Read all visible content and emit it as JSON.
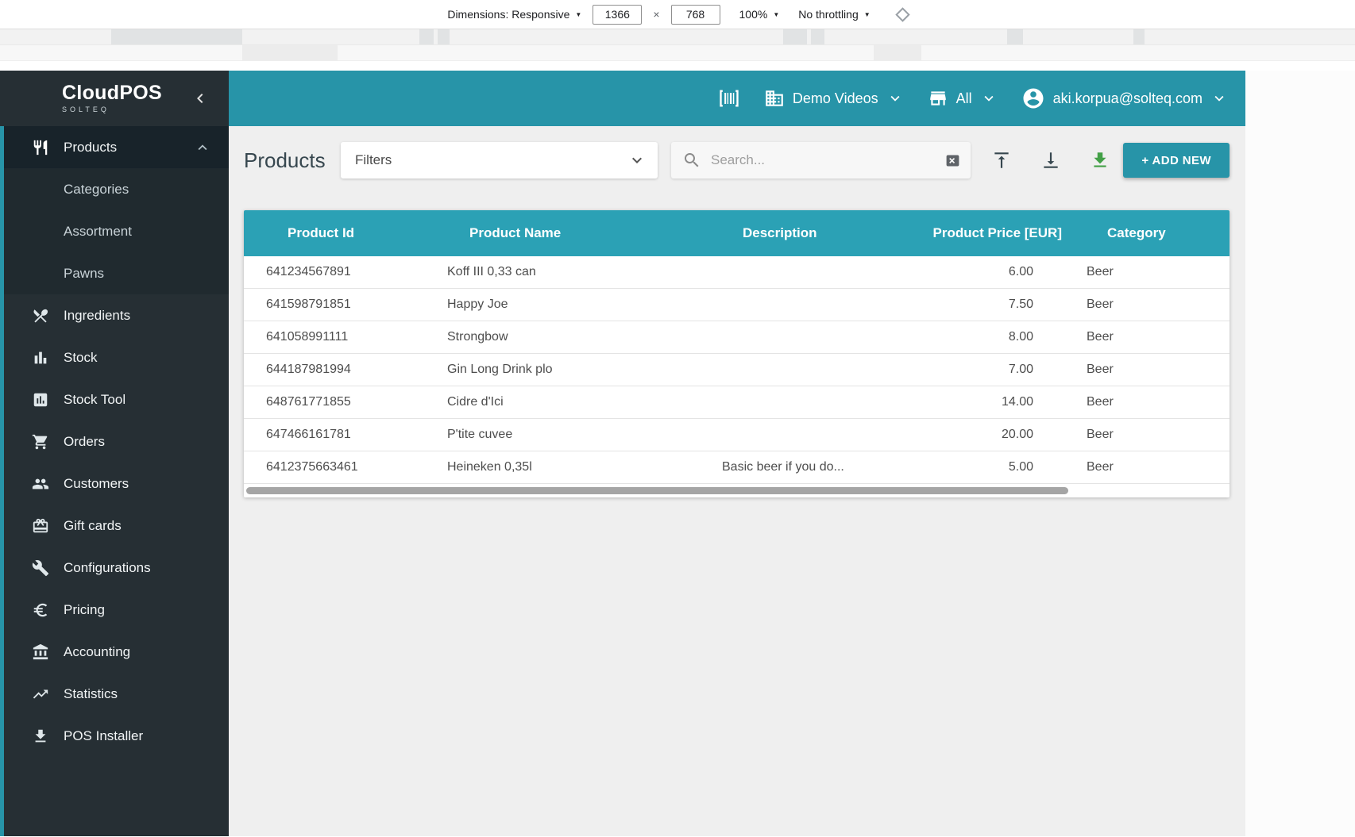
{
  "devtools": {
    "dimensions_label": "Dimensions: Responsive",
    "width": "1366",
    "times": "×",
    "height": "768",
    "zoom": "100%",
    "throttling": "No throttling"
  },
  "sidebar": {
    "logo_title": "CloudPOS",
    "logo_subtitle": "SOLTEQ",
    "items": [
      {
        "label": "Products"
      },
      {
        "label": "Categories"
      },
      {
        "label": "Assortment"
      },
      {
        "label": "Pawns"
      },
      {
        "label": "Ingredients"
      },
      {
        "label": "Stock"
      },
      {
        "label": "Stock Tool"
      },
      {
        "label": "Orders"
      },
      {
        "label": "Customers"
      },
      {
        "label": "Gift cards"
      },
      {
        "label": "Configurations"
      },
      {
        "label": "Pricing"
      },
      {
        "label": "Accounting"
      },
      {
        "label": "Statistics"
      },
      {
        "label": "POS Installer"
      }
    ]
  },
  "topbar": {
    "company": "Demo Videos",
    "store_filter": "All",
    "user_email": "aki.korpua@solteq.com"
  },
  "page": {
    "title": "Products",
    "filters_label": "Filters",
    "search_placeholder": "Search...",
    "add_new_label": "+ ADD NEW"
  },
  "table": {
    "columns": [
      "Product Id",
      "Product Name",
      "Description",
      "Product Price [EUR]",
      "Category"
    ],
    "rows": [
      {
        "id": "641234567891",
        "name": "Koff III 0,33 can",
        "description": "",
        "price": "6.00",
        "category": "Beer"
      },
      {
        "id": "641598791851",
        "name": "Happy Joe",
        "description": "",
        "price": "7.50",
        "category": "Beer"
      },
      {
        "id": "641058991111",
        "name": "Strongbow",
        "description": "",
        "price": "8.00",
        "category": "Beer"
      },
      {
        "id": "644187981994",
        "name": "Gin Long Drink plo",
        "description": "",
        "price": "7.00",
        "category": "Beer"
      },
      {
        "id": "648761771855",
        "name": "Cidre d'Ici",
        "description": "",
        "price": "14.00",
        "category": "Beer"
      },
      {
        "id": "647466161781",
        "name": "P'tite cuvee",
        "description": "",
        "price": "20.00",
        "category": "Beer"
      },
      {
        "id": "6412375663461",
        "name": "Heineken 0,35l",
        "description": "Basic beer if you do...",
        "price": "5.00",
        "category": "Beer"
      }
    ]
  },
  "colors": {
    "topbar_teal": "#2794a8",
    "table_header_teal": "#2ba1b5",
    "green_accent": "#43a047",
    "sidebar_bg": "#262f34"
  }
}
